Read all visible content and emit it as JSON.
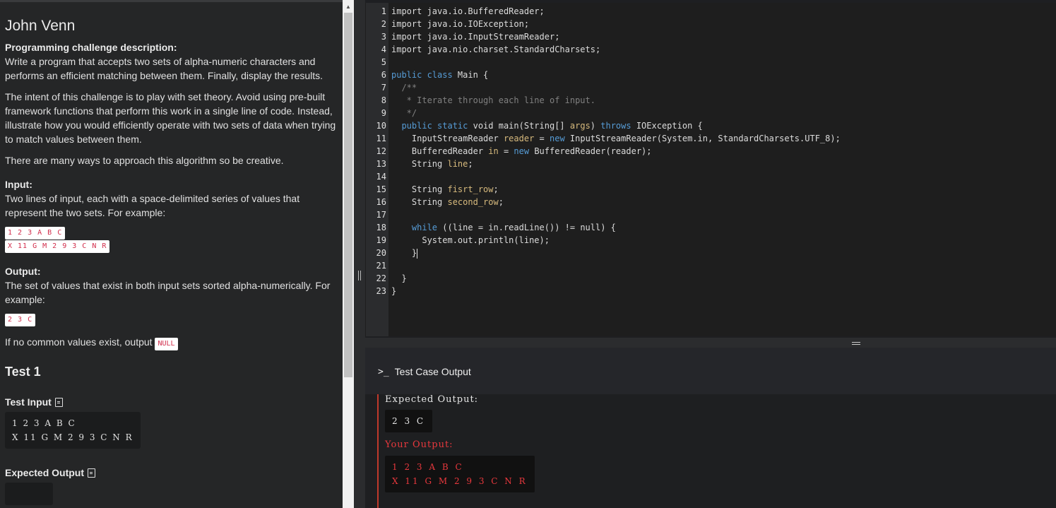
{
  "problem": {
    "title": "John Venn",
    "desc_heading": "Programming challenge description:",
    "p1": "Write a program that accepts two sets of alpha-numeric characters and performs an efficient matching between them. Finally, display the results.",
    "p2": "The intent of this challenge is to play with set theory. Avoid using pre-built framework functions that perform this work in a single line of code. Instead, illustrate how you would efficiently operate with two sets of data when trying to match values between them.",
    "p3": "There are many ways to approach this algorithm so be creative.",
    "input_heading": "Input:",
    "input_text": "Two lines of input, each with a space-delimited series of values that represent the two sets. For example:",
    "input_example_1": "1 2 3 A B C",
    "input_example_2": "X 11 G M 2 9 3 C N R",
    "output_heading": "Output:",
    "output_text": "The set of values that exist in both input sets sorted alpha-numerically. For example:",
    "output_example": "2 3 C",
    "null_text": "If no common values exist, output",
    "null_code": "NULL",
    "test_heading": "Test 1",
    "test_input_label": "Test Input",
    "test_input_1": "1 2 3 A B C",
    "test_input_2": "X 11 G M 2 9 3 C N R",
    "expected_label": "Expected Output"
  },
  "editor": {
    "lines": [
      {
        "n": "1",
        "code": [
          [
            "plain",
            "import java.io.BufferedReader;"
          ]
        ]
      },
      {
        "n": "2",
        "code": [
          [
            "plain",
            "import java.io.IOException;"
          ]
        ]
      },
      {
        "n": "3",
        "code": [
          [
            "plain",
            "import java.io.InputStreamReader;"
          ]
        ]
      },
      {
        "n": "4",
        "code": [
          [
            "plain",
            "import java.nio.charset.StandardCharsets;"
          ]
        ]
      },
      {
        "n": "5",
        "code": []
      },
      {
        "n": "6",
        "code": [
          [
            "kw",
            "public class "
          ],
          [
            "plain",
            "Main {"
          ]
        ]
      },
      {
        "n": "7",
        "code": [
          [
            "cm",
            "  /**"
          ]
        ]
      },
      {
        "n": "8",
        "code": [
          [
            "cm",
            "   * Iterate through each line of input."
          ]
        ]
      },
      {
        "n": "9",
        "code": [
          [
            "cm",
            "   */"
          ]
        ]
      },
      {
        "n": "10",
        "code": [
          [
            "plain",
            "  "
          ],
          [
            "kw",
            "public static "
          ],
          [
            "plain",
            "void main(String[] "
          ],
          [
            "var",
            "args"
          ],
          [
            "plain",
            ") "
          ],
          [
            "kw",
            "throws "
          ],
          [
            "plain",
            "IOException {"
          ]
        ]
      },
      {
        "n": "11",
        "code": [
          [
            "plain",
            "    InputStreamReader "
          ],
          [
            "var",
            "reader"
          ],
          [
            "plain",
            " = "
          ],
          [
            "kw",
            "new "
          ],
          [
            "plain",
            "InputStreamReader(System.in, StandardCharsets.UTF_8);"
          ]
        ]
      },
      {
        "n": "12",
        "code": [
          [
            "plain",
            "    BufferedReader "
          ],
          [
            "var",
            "in"
          ],
          [
            "plain",
            " = "
          ],
          [
            "kw",
            "new "
          ],
          [
            "plain",
            "BufferedReader(reader);"
          ]
        ]
      },
      {
        "n": "13",
        "code": [
          [
            "plain",
            "    String "
          ],
          [
            "var",
            "line"
          ],
          [
            "plain",
            ";"
          ]
        ]
      },
      {
        "n": "14",
        "code": []
      },
      {
        "n": "15",
        "code": [
          [
            "plain",
            "    String "
          ],
          [
            "var",
            "fisrt_row"
          ],
          [
            "plain",
            ";"
          ]
        ]
      },
      {
        "n": "16",
        "code": [
          [
            "plain",
            "    String "
          ],
          [
            "var",
            "second_row"
          ],
          [
            "plain",
            ";"
          ]
        ]
      },
      {
        "n": "17",
        "code": []
      },
      {
        "n": "18",
        "code": [
          [
            "plain",
            "    "
          ],
          [
            "kw",
            "while "
          ],
          [
            "plain",
            "((line = in.readLine()) != null) {"
          ]
        ]
      },
      {
        "n": "19",
        "code": [
          [
            "plain",
            "      System.out.println(line);"
          ]
        ]
      },
      {
        "n": "20",
        "code": [
          [
            "plain",
            "    }"
          ],
          [
            "cursor",
            ""
          ]
        ]
      },
      {
        "n": "21",
        "code": []
      },
      {
        "n": "22",
        "code": [
          [
            "plain",
            "  }"
          ]
        ]
      },
      {
        "n": "23",
        "code": [
          [
            "plain",
            "}"
          ]
        ]
      }
    ]
  },
  "output": {
    "title": "Test Case Output",
    "terminal_icon": ">_",
    "expected_label": "Expected Output:",
    "expected_value": "2 3 C",
    "your_label": "Your Output:",
    "your_line_1": "1 2 3 A B C",
    "your_line_2": "X 11 G M 2 9 3 C N R",
    "colors": {
      "error": "#e8383d",
      "accent": "#c0392b"
    }
  },
  "icons": [
    "doc-icon",
    "terminal-icon",
    "scroll-up-icon"
  ]
}
